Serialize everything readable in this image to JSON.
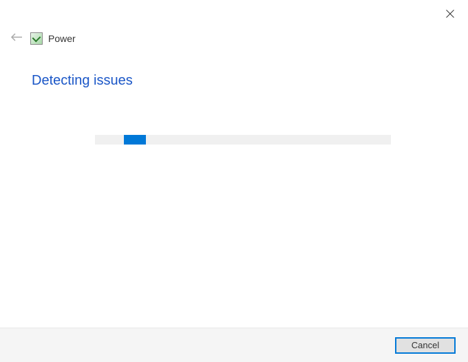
{
  "window": {
    "close_icon": "close",
    "back_icon": "back"
  },
  "header": {
    "title": "Power",
    "icon": "power-troubleshooter-icon"
  },
  "main": {
    "heading": "Detecting issues",
    "progress": {
      "indeterminate": true,
      "indicator_offset_percent": 10,
      "indicator_width_percent": 7
    }
  },
  "footer": {
    "cancel_label": "Cancel"
  }
}
